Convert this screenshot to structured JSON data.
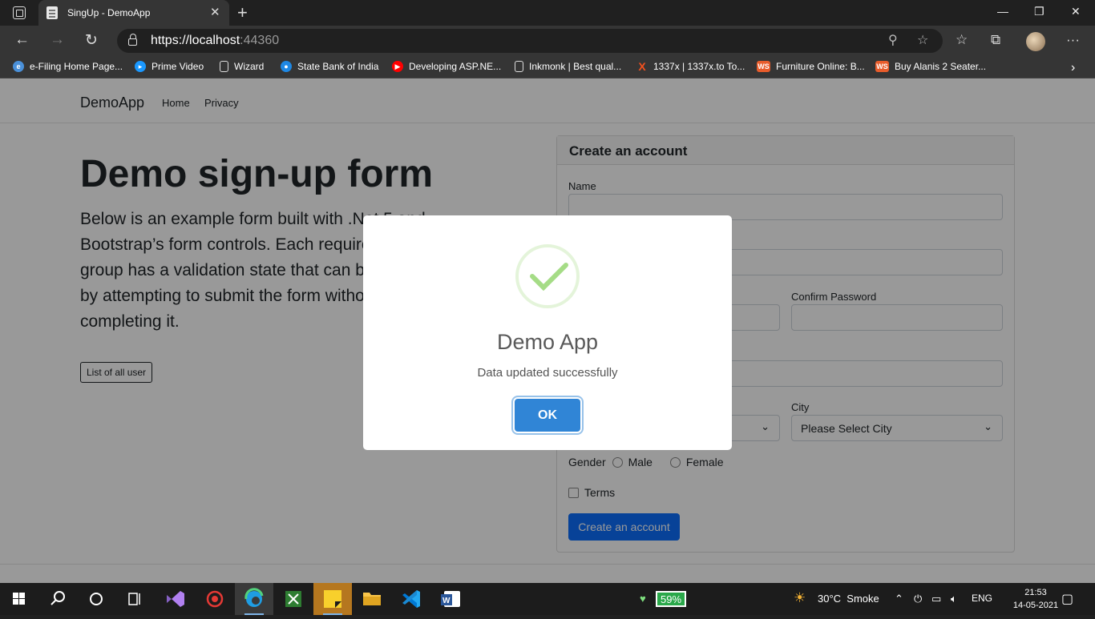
{
  "browser": {
    "tab_title": "SingUp - DemoApp",
    "tab_close": "✕",
    "new_tab": "+",
    "window_controls": {
      "minimize": "—",
      "maximize": "❐",
      "close": "✕"
    },
    "url_main": "https://localhost",
    "url_port": ":44360",
    "bookmarks": [
      {
        "label": "e-Filing Home Page...",
        "icon": "efiling-icon",
        "color": "#4a90d9"
      },
      {
        "label": "Prime Video",
        "icon": "prime-video-icon",
        "color": "#1a98ff"
      },
      {
        "label": "Wizard",
        "icon": "page-icon",
        "color": "#353535"
      },
      {
        "label": "State Bank of India",
        "icon": "sbi-icon",
        "color": "#1e88e5"
      },
      {
        "label": "Developing ASP.NE...",
        "icon": "youtube-icon",
        "color": "#ff0000"
      },
      {
        "label": "Inkmonk | Best qual...",
        "icon": "page-icon",
        "color": "#353535"
      },
      {
        "label": "1337x | 1337x.to To...",
        "icon": "x-icon",
        "color": "#f4511e"
      },
      {
        "label": "Furniture Online: B...",
        "icon": "ws-icon",
        "color": "#e85c2b"
      },
      {
        "label": "Buy Alanis 2 Seater...",
        "icon": "ws-icon",
        "color": "#e85c2b"
      }
    ]
  },
  "site": {
    "brand": "DemoApp",
    "nav": [
      "Home",
      "Privacy"
    ],
    "heading": "Demo sign-up form",
    "lead": "Below is an example form built with .Net 5 and Bootstrap’s form controls. Each required form group has a validation state that can be triggered by attempting to submit the form without completing it.",
    "list_button": "List of all user"
  },
  "form": {
    "header": "Create an account",
    "name_label": "Name",
    "confirm_password_label": "Confirm Password",
    "city_label": "City",
    "city_value": "Please Select City",
    "gender_label": "Gender",
    "gender_options": [
      "Male",
      "Female"
    ],
    "terms_label": "Terms",
    "submit_label": "Create an account"
  },
  "modal": {
    "title": "Demo App",
    "text": "Data updated successfully",
    "ok_label": "OK",
    "success_color": "#a5dc86",
    "ok_color": "#3085d6"
  },
  "taskbar": {
    "battery": "59%",
    "weather": "30°C  Smoke",
    "language": "ENG",
    "time": "21:53",
    "date": "14-05-2021"
  }
}
